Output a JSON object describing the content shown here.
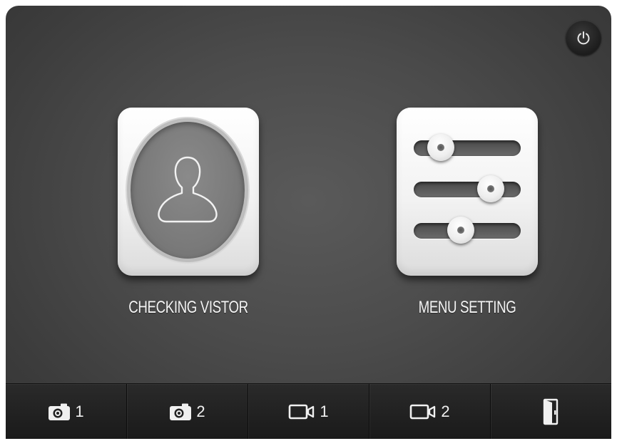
{
  "tiles": {
    "visitor": {
      "label": "CHECKING VISTOR",
      "icon": "person-icon"
    },
    "menu": {
      "label": "MENU SETTING",
      "icon": "sliders-icon",
      "sliders": [
        0.25,
        0.72,
        0.44
      ]
    }
  },
  "power": {
    "icon": "power-icon"
  },
  "toolbar": {
    "items": [
      {
        "icon": "camera-icon",
        "number": "1"
      },
      {
        "icon": "camera-icon",
        "number": "2"
      },
      {
        "icon": "video-camera-icon",
        "number": "1"
      },
      {
        "icon": "video-camera-icon",
        "number": "2"
      },
      {
        "icon": "door-icon",
        "number": ""
      }
    ]
  },
  "colors": {
    "background": "#4b4b4b",
    "tile": "#f2f2f2",
    "toolbar": "#1f1f1f",
    "text": "#f4f4f4"
  }
}
